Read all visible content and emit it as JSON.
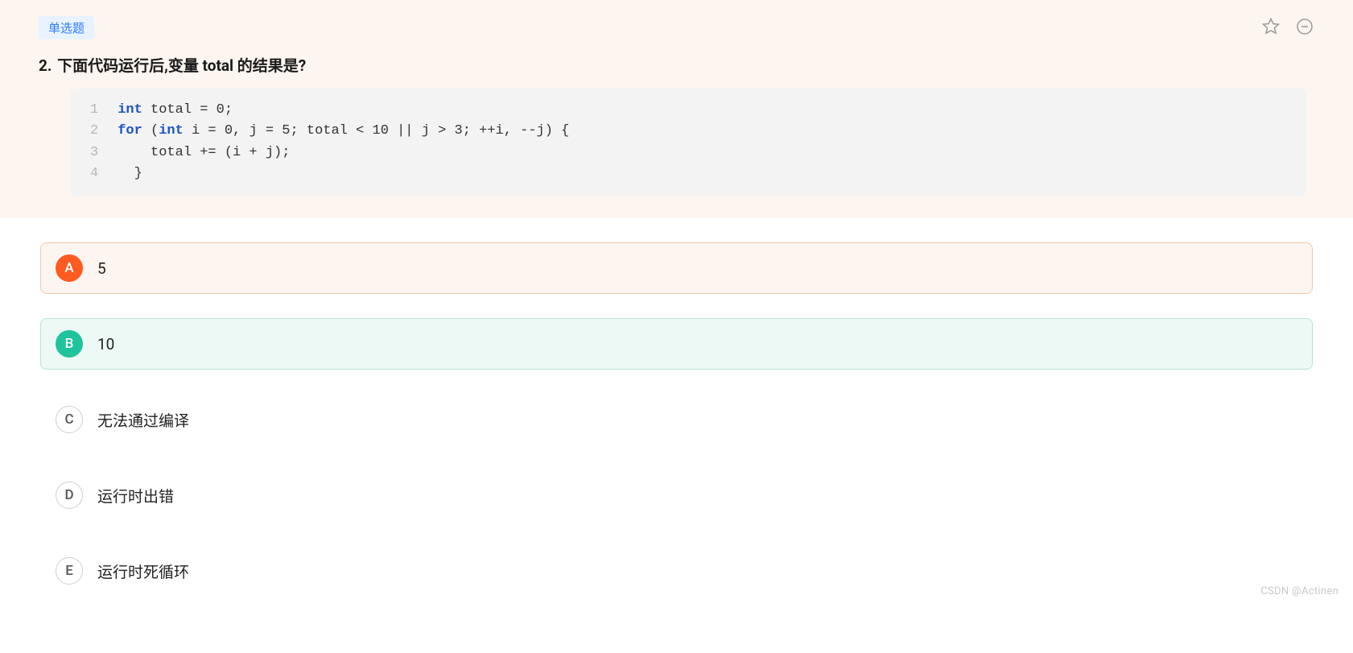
{
  "question": {
    "type_label": "单选题",
    "number": "2.",
    "title": "下面代码运行后,变量 total 的结果是?",
    "code": {
      "line_numbers": [
        "1",
        "2",
        "3",
        "4"
      ],
      "lines": [
        "int total = 0;",
        "for (int i = 0, j = 5; total < 10 || j > 3; ++i, --j) {",
        "    total += (i + j);",
        "  }"
      ]
    }
  },
  "options": [
    {
      "letter": "A",
      "text": "5",
      "state": "wrong"
    },
    {
      "letter": "B",
      "text": "10",
      "state": "right"
    },
    {
      "letter": "C",
      "text": "无法通过编译",
      "state": "default"
    },
    {
      "letter": "D",
      "text": "运行时出错",
      "state": "default"
    },
    {
      "letter": "E",
      "text": "运行时死循环",
      "state": "default"
    }
  ],
  "watermark": "CSDN @Actinen"
}
